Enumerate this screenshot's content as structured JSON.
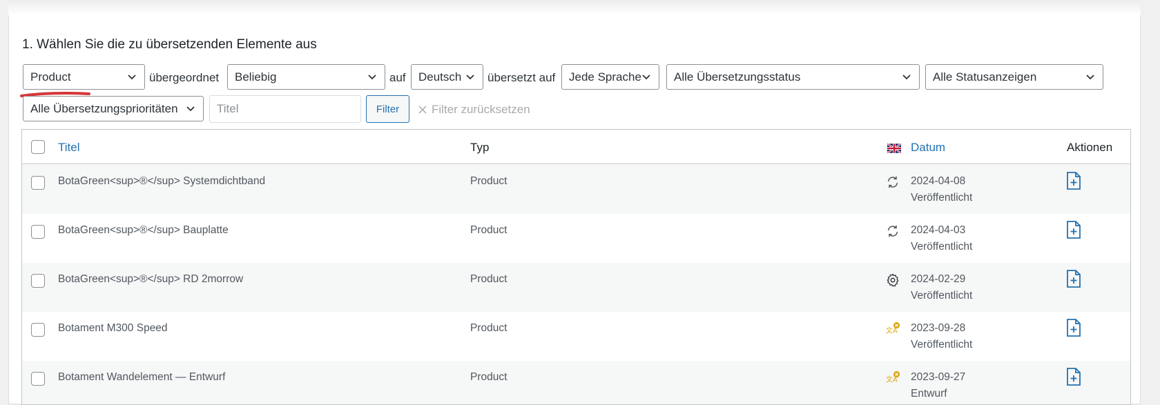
{
  "heading": "1. Wählen Sie die zu übersetzenden Elemente aus",
  "filters": {
    "type_select": "Product",
    "parent_label": "übergeordnet",
    "parent_select": "Beliebig",
    "on_label": "auf",
    "language_select": "Deutsch",
    "translated_label": "übersetzt auf",
    "target_language_select": "Jede Sprache",
    "translation_status_select": "Alle Übersetzungsstatus",
    "status_select": "Alle Statusanzeigen",
    "priority_select": "Alle Übersetzungsprioritäten",
    "title_placeholder": "Titel",
    "filter_button": "Filter",
    "reset_label": "Filter zurücksetzen"
  },
  "table": {
    "headers": {
      "title": "Titel",
      "type": "Typ",
      "date": "Datum",
      "actions": "Aktionen"
    },
    "rows": [
      {
        "title": "BotaGreen<sup>®</sup> Systemdichtband",
        "type": "Product",
        "date": "2024-04-08",
        "status": "Veröffentlicht",
        "icon": "sync-icon"
      },
      {
        "title": "BotaGreen<sup>®</sup> Bauplatte",
        "type": "Product",
        "date": "2024-04-03",
        "status": "Veröffentlicht",
        "icon": "sync-icon"
      },
      {
        "title": "BotaGreen<sup>®</sup> RD 2morrow",
        "type": "Product",
        "date": "2024-02-29",
        "status": "Veröffentlicht",
        "icon": "gear-icon"
      },
      {
        "title": "Botament M300 Speed",
        "type": "Product",
        "date": "2023-09-28",
        "status": "Veröffentlicht",
        "icon": "translation-missing-icon"
      },
      {
        "title": "Botament Wandelement — Entwurf",
        "type": "Product",
        "date": "2023-09-27",
        "status": "Entwurf",
        "icon": "translation-missing-icon"
      }
    ]
  },
  "colors": {
    "link": "#2271b1",
    "annotation": "#d63638",
    "warning": "#dba617"
  }
}
